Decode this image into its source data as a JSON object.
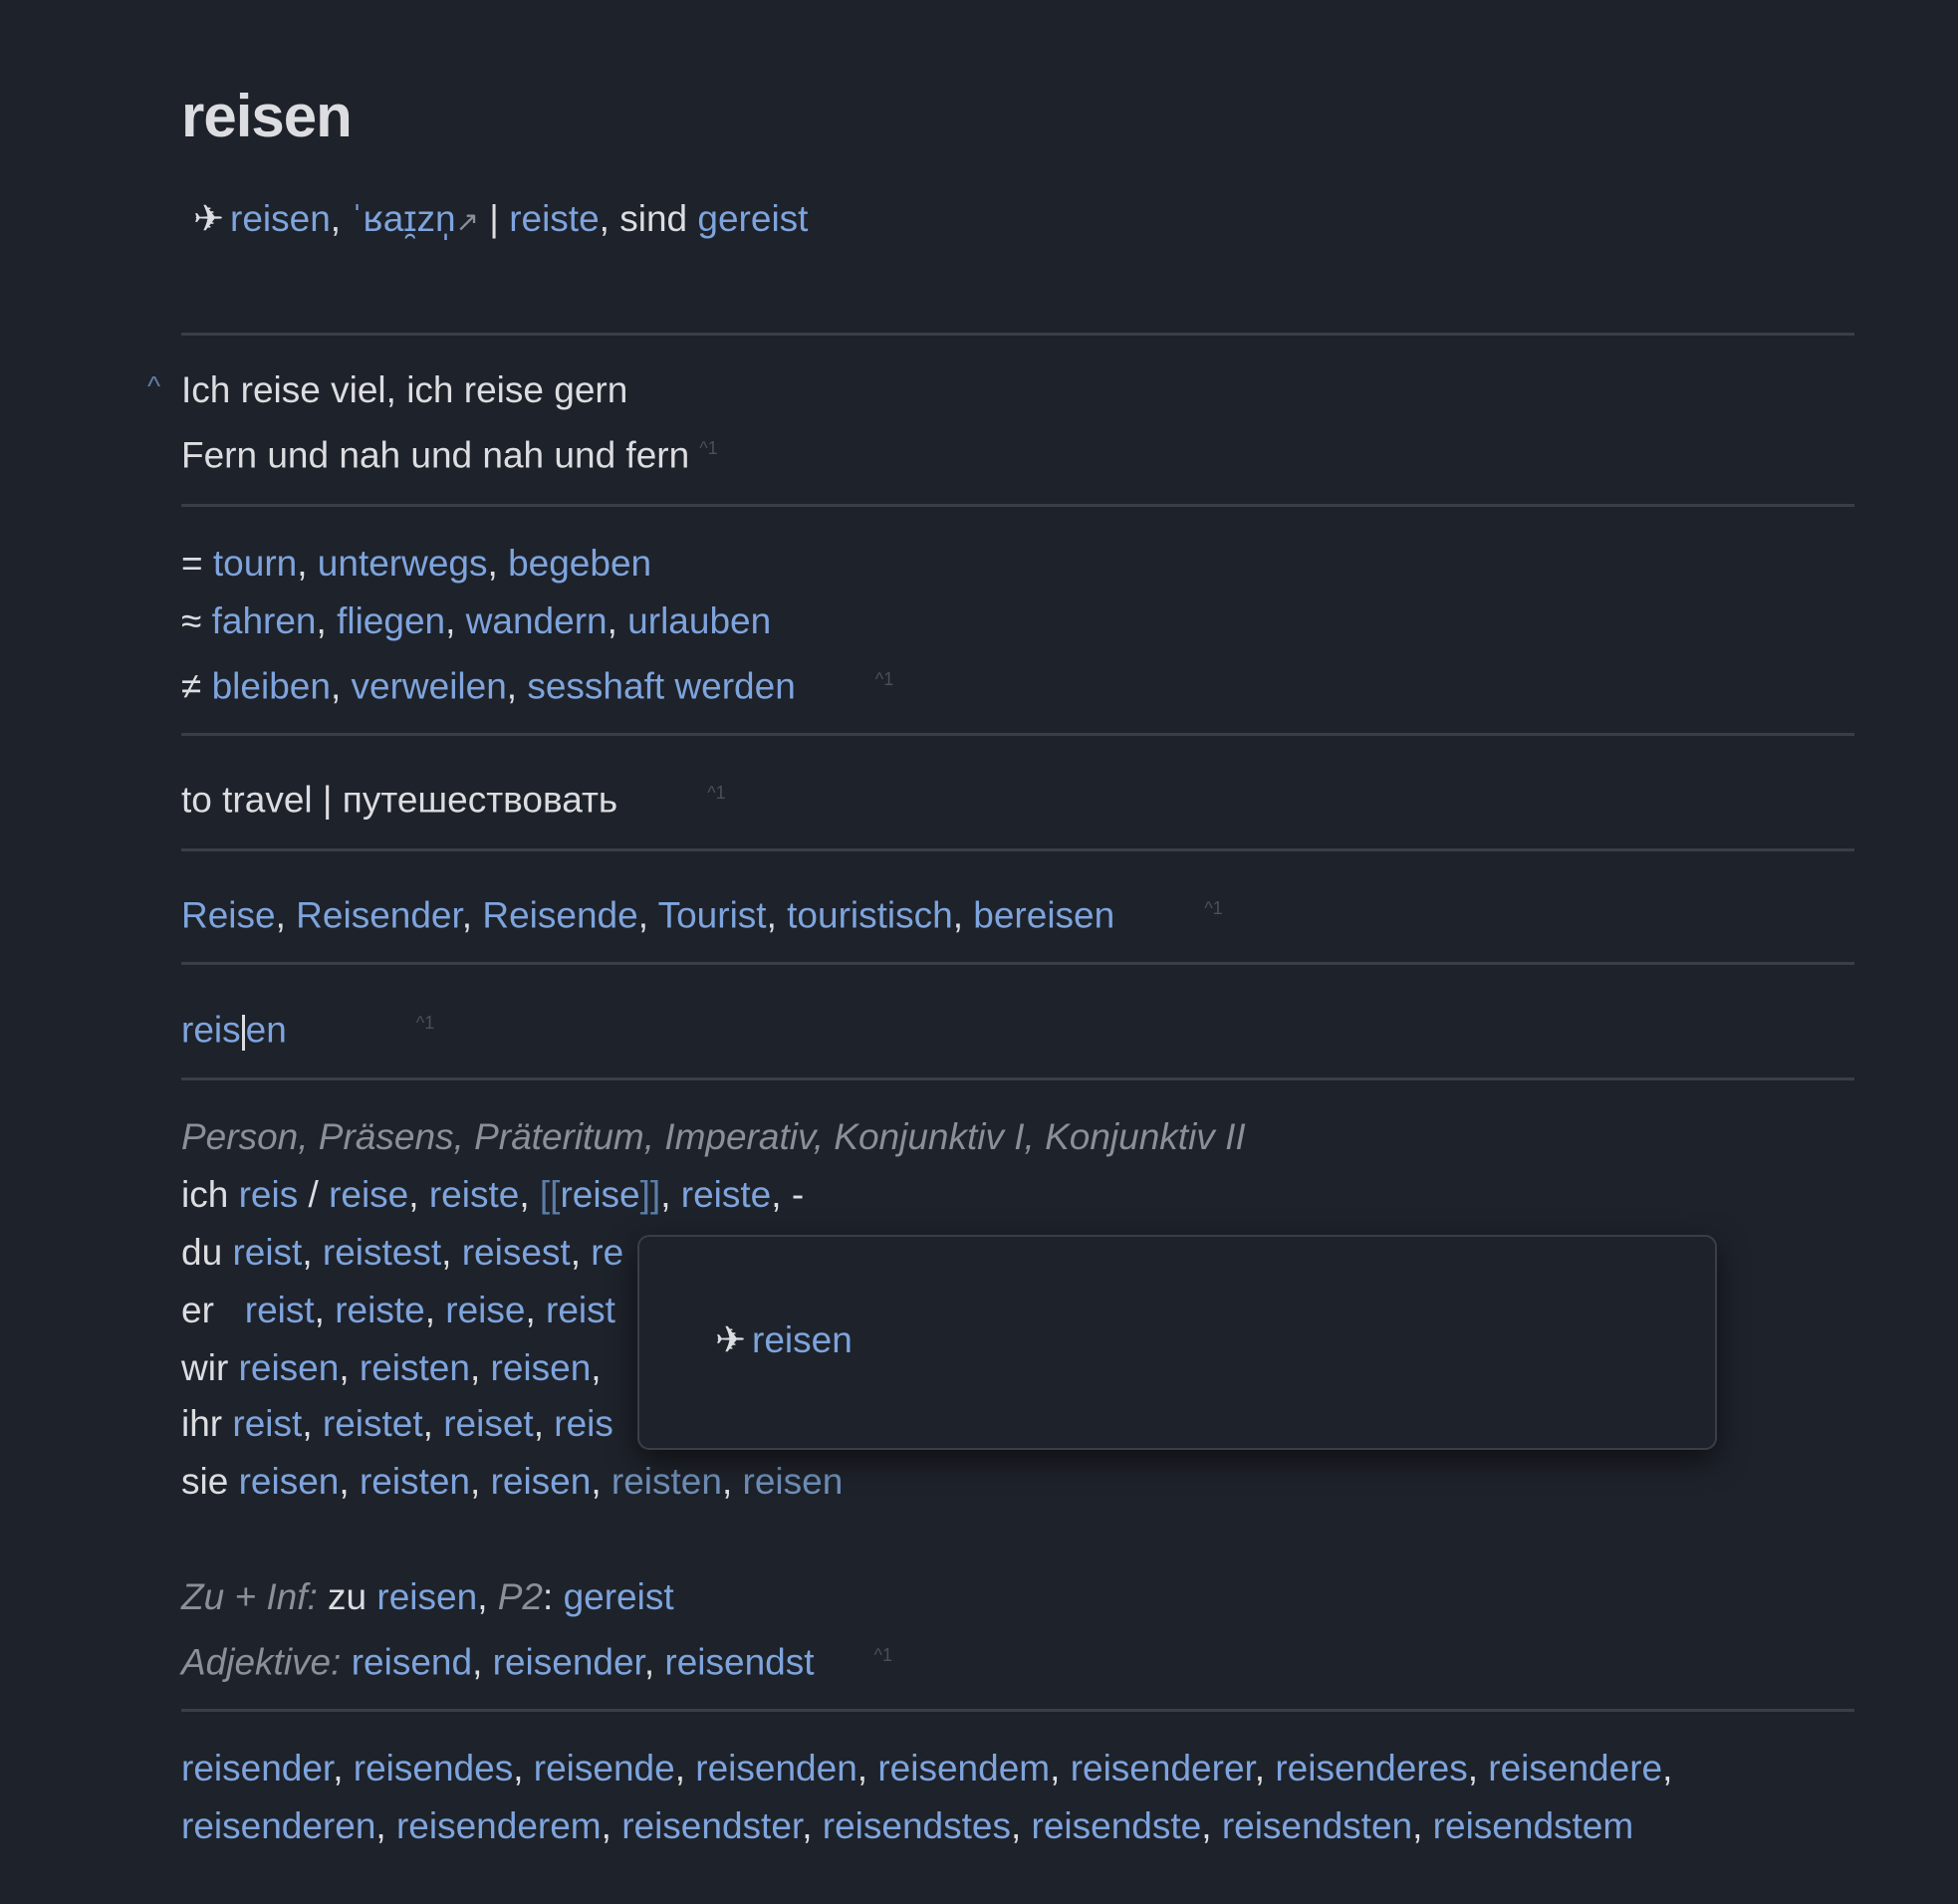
{
  "title": "reisen",
  "header": {
    "plane_icon": "airplane-icon",
    "word": "reisen",
    "ipa": "ˈʁaɪ̯zn̩",
    "external_link_icon": "external-link-icon",
    "sep": " | ",
    "praeteritum": "reiste",
    "sind": "sind",
    "partizip": "gereist"
  },
  "example": {
    "collapse_icon": "^",
    "line1": "Ich reise viel, ich reise gern",
    "line2": "Fern und nah und nah und fern",
    "fn": "^1"
  },
  "synonyms": {
    "eq_sym": "=",
    "eq": [
      "tourn",
      "unterwegs",
      "begeben"
    ],
    "approx_sym": "≈",
    "approx": [
      "fahren",
      "fliegen",
      "wandern",
      "urlauben"
    ],
    "neq_sym": "≠",
    "neq": [
      "bleiben",
      "verweilen",
      "sesshaft werden"
    ],
    "fn": "^1"
  },
  "translation": {
    "text": "to travel | путешествовать",
    "fn": "^1"
  },
  "related": {
    "words": [
      "Reise",
      "Reisender",
      "Reisende",
      "Tourist",
      "touristisch",
      "bereisen"
    ],
    "fn": "^1"
  },
  "stem": {
    "part1": "reis",
    "part2": "en",
    "fn": "^1"
  },
  "conjugation": {
    "header": "Person, Präsens, Präteritum, Imperativ, Konjunktiv I, Konjunktiv II",
    "ich": {
      "pron": "ich",
      "w1": "reis",
      "slash": "/",
      "w2": "reise",
      "w3": "reiste",
      "w4_open": "[[",
      "w4": "reise",
      "w4_close": "]]",
      "w5": "reiste",
      "w6": "-"
    },
    "du": {
      "pron": "du",
      "w1": "reist",
      "w2": "reistest",
      "w3": "reisest",
      "w4": "re"
    },
    "er": {
      "pron": "er",
      "w1": "reist",
      "w2": "reiste",
      "w3": "reise",
      "w4": "reist"
    },
    "wir": {
      "pron": "wir",
      "w1": "reisen",
      "w2": "reisten",
      "w3": "reisen"
    },
    "ihr": {
      "pron": "ihr",
      "w1": "reist",
      "w2": "reistet",
      "w3": "reiset",
      "w4": "reis"
    },
    "sie": {
      "pron": "sie",
      "w1": "reisen",
      "w2": "reisten",
      "w3": "reisen",
      "w4": "reisten",
      "w5": "reisen"
    },
    "zu_label": "Zu + Inf:",
    "zu": "zu",
    "zu_word": "reisen",
    "p2_label": "P2",
    "p2_word": "gereist",
    "adj_label": "Adjektive:",
    "adj": [
      "reisend",
      "reisender",
      "reisendst"
    ],
    "fn": "^1"
  },
  "declension": {
    "row1": [
      "reisender",
      "reisendes",
      "reisende",
      "reisenden",
      "reisendem",
      "reisenderer",
      "reisenderes",
      "reisendere"
    ],
    "row2": [
      "reisenderen",
      "reisenderem",
      "reisendster",
      "reisendstes",
      "reisendste",
      "reisendsten",
      "reisendstem"
    ]
  },
  "popup": {
    "icon": "airplane-icon",
    "word": "reisen"
  }
}
